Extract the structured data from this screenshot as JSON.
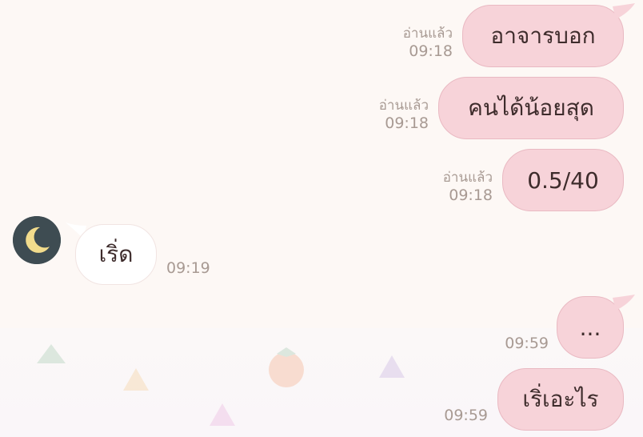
{
  "chat": {
    "messages": [
      {
        "side": "out",
        "text": "อาจารบอก",
        "read": "อ่านแล้ว",
        "time": "09:18"
      },
      {
        "side": "out",
        "text": "คนได้น้อยสุด",
        "read": "อ่านแล้ว",
        "time": "09:18"
      },
      {
        "side": "out",
        "text": "0.5/40",
        "read": "อ่านแล้ว",
        "time": "09:18"
      },
      {
        "side": "in",
        "text": "เริ่ด",
        "time": "09:19",
        "avatar_icon": "moon-icon"
      },
      {
        "side": "out",
        "text": "...",
        "time": "09:59"
      },
      {
        "side": "out",
        "text": "เริ่เอะไร",
        "time": "09:59"
      }
    ]
  },
  "colors": {
    "outgoing_bubble": "#f7d3d9",
    "incoming_bubble": "#ffffff",
    "background": "#fdf8f5",
    "meta_text": "#a89a93",
    "avatar_bg": "#3e4c52",
    "moon": "#f2dc8c"
  }
}
